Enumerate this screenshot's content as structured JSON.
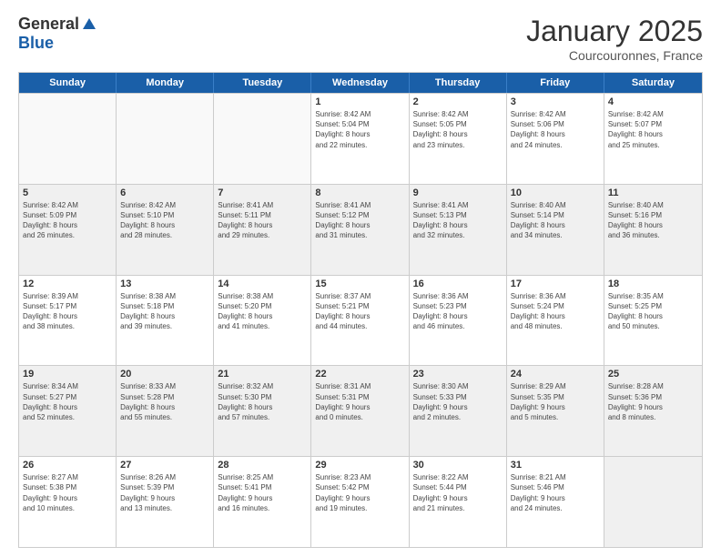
{
  "header": {
    "logo_general": "General",
    "logo_blue": "Blue",
    "month_title": "January 2025",
    "location": "Courcouronnes, France"
  },
  "weekdays": [
    "Sunday",
    "Monday",
    "Tuesday",
    "Wednesday",
    "Thursday",
    "Friday",
    "Saturday"
  ],
  "rows": [
    [
      {
        "day": "",
        "info": ""
      },
      {
        "day": "",
        "info": ""
      },
      {
        "day": "",
        "info": ""
      },
      {
        "day": "1",
        "info": "Sunrise: 8:42 AM\nSunset: 5:04 PM\nDaylight: 8 hours\nand 22 minutes."
      },
      {
        "day": "2",
        "info": "Sunrise: 8:42 AM\nSunset: 5:05 PM\nDaylight: 8 hours\nand 23 minutes."
      },
      {
        "day": "3",
        "info": "Sunrise: 8:42 AM\nSunset: 5:06 PM\nDaylight: 8 hours\nand 24 minutes."
      },
      {
        "day": "4",
        "info": "Sunrise: 8:42 AM\nSunset: 5:07 PM\nDaylight: 8 hours\nand 25 minutes."
      }
    ],
    [
      {
        "day": "5",
        "info": "Sunrise: 8:42 AM\nSunset: 5:09 PM\nDaylight: 8 hours\nand 26 minutes."
      },
      {
        "day": "6",
        "info": "Sunrise: 8:42 AM\nSunset: 5:10 PM\nDaylight: 8 hours\nand 28 minutes."
      },
      {
        "day": "7",
        "info": "Sunrise: 8:41 AM\nSunset: 5:11 PM\nDaylight: 8 hours\nand 29 minutes."
      },
      {
        "day": "8",
        "info": "Sunrise: 8:41 AM\nSunset: 5:12 PM\nDaylight: 8 hours\nand 31 minutes."
      },
      {
        "day": "9",
        "info": "Sunrise: 8:41 AM\nSunset: 5:13 PM\nDaylight: 8 hours\nand 32 minutes."
      },
      {
        "day": "10",
        "info": "Sunrise: 8:40 AM\nSunset: 5:14 PM\nDaylight: 8 hours\nand 34 minutes."
      },
      {
        "day": "11",
        "info": "Sunrise: 8:40 AM\nSunset: 5:16 PM\nDaylight: 8 hours\nand 36 minutes."
      }
    ],
    [
      {
        "day": "12",
        "info": "Sunrise: 8:39 AM\nSunset: 5:17 PM\nDaylight: 8 hours\nand 38 minutes."
      },
      {
        "day": "13",
        "info": "Sunrise: 8:38 AM\nSunset: 5:18 PM\nDaylight: 8 hours\nand 39 minutes."
      },
      {
        "day": "14",
        "info": "Sunrise: 8:38 AM\nSunset: 5:20 PM\nDaylight: 8 hours\nand 41 minutes."
      },
      {
        "day": "15",
        "info": "Sunrise: 8:37 AM\nSunset: 5:21 PM\nDaylight: 8 hours\nand 44 minutes."
      },
      {
        "day": "16",
        "info": "Sunrise: 8:36 AM\nSunset: 5:23 PM\nDaylight: 8 hours\nand 46 minutes."
      },
      {
        "day": "17",
        "info": "Sunrise: 8:36 AM\nSunset: 5:24 PM\nDaylight: 8 hours\nand 48 minutes."
      },
      {
        "day": "18",
        "info": "Sunrise: 8:35 AM\nSunset: 5:25 PM\nDaylight: 8 hours\nand 50 minutes."
      }
    ],
    [
      {
        "day": "19",
        "info": "Sunrise: 8:34 AM\nSunset: 5:27 PM\nDaylight: 8 hours\nand 52 minutes."
      },
      {
        "day": "20",
        "info": "Sunrise: 8:33 AM\nSunset: 5:28 PM\nDaylight: 8 hours\nand 55 minutes."
      },
      {
        "day": "21",
        "info": "Sunrise: 8:32 AM\nSunset: 5:30 PM\nDaylight: 8 hours\nand 57 minutes."
      },
      {
        "day": "22",
        "info": "Sunrise: 8:31 AM\nSunset: 5:31 PM\nDaylight: 9 hours\nand 0 minutes."
      },
      {
        "day": "23",
        "info": "Sunrise: 8:30 AM\nSunset: 5:33 PM\nDaylight: 9 hours\nand 2 minutes."
      },
      {
        "day": "24",
        "info": "Sunrise: 8:29 AM\nSunset: 5:35 PM\nDaylight: 9 hours\nand 5 minutes."
      },
      {
        "day": "25",
        "info": "Sunrise: 8:28 AM\nSunset: 5:36 PM\nDaylight: 9 hours\nand 8 minutes."
      }
    ],
    [
      {
        "day": "26",
        "info": "Sunrise: 8:27 AM\nSunset: 5:38 PM\nDaylight: 9 hours\nand 10 minutes."
      },
      {
        "day": "27",
        "info": "Sunrise: 8:26 AM\nSunset: 5:39 PM\nDaylight: 9 hours\nand 13 minutes."
      },
      {
        "day": "28",
        "info": "Sunrise: 8:25 AM\nSunset: 5:41 PM\nDaylight: 9 hours\nand 16 minutes."
      },
      {
        "day": "29",
        "info": "Sunrise: 8:23 AM\nSunset: 5:42 PM\nDaylight: 9 hours\nand 19 minutes."
      },
      {
        "day": "30",
        "info": "Sunrise: 8:22 AM\nSunset: 5:44 PM\nDaylight: 9 hours\nand 21 minutes."
      },
      {
        "day": "31",
        "info": "Sunrise: 8:21 AM\nSunset: 5:46 PM\nDaylight: 9 hours\nand 24 minutes."
      },
      {
        "day": "",
        "info": ""
      }
    ]
  ]
}
